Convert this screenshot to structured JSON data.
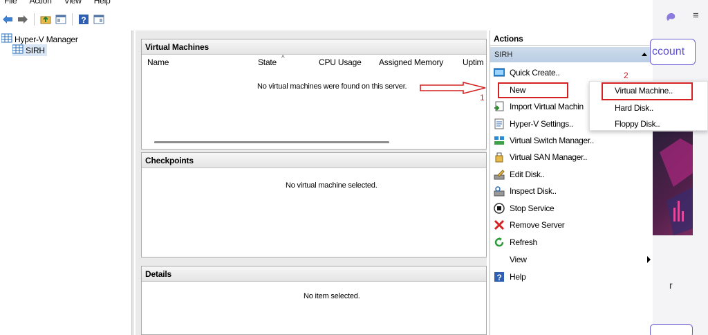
{
  "menu": [
    "File",
    "Action",
    "View",
    "Help"
  ],
  "tree": {
    "root": "Hyper-V Manager",
    "child": "SIRH"
  },
  "vm_panel": {
    "title": "Virtual Machines",
    "columns": [
      "Name",
      "State",
      "CPU Usage",
      "Assigned Memory",
      "Uptim"
    ],
    "sort_indicator": "^",
    "empty_message": "No virtual machines were found on this server."
  },
  "checkpoints": {
    "title": "Checkpoints",
    "message": "No virtual machine selected."
  },
  "details": {
    "title": "Details",
    "message": "No item selected."
  },
  "actions": {
    "header": "Actions",
    "group": "SIRH",
    "items": [
      {
        "label": "Quick Create..",
        "icon": "quick-create-icon"
      },
      {
        "label": "New",
        "icon": "none"
      },
      {
        "label": "Import Virtual Machin",
        "icon": "import-icon"
      },
      {
        "label": "Hyper-V Settings..",
        "icon": "settings-icon"
      },
      {
        "label": "Virtual Switch Manager..",
        "icon": "switch-icon"
      },
      {
        "label": "Virtual SAN Manager..",
        "icon": "san-icon"
      },
      {
        "label": "Edit Disk..",
        "icon": "edit-disk-icon"
      },
      {
        "label": "Inspect Disk..",
        "icon": "inspect-disk-icon"
      },
      {
        "label": "Stop Service",
        "icon": "stop-icon"
      },
      {
        "label": "Remove Server",
        "icon": "remove-icon"
      },
      {
        "label": "Refresh",
        "icon": "refresh-icon"
      },
      {
        "label": "View",
        "icon": "none"
      },
      {
        "label": "Help",
        "icon": "help-icon"
      }
    ]
  },
  "submenu": [
    "Virtual Machine..",
    "Hard Disk..",
    "Floppy Disk.."
  ],
  "annotations": {
    "step1": "1",
    "step2": "2"
  },
  "background": {
    "account_label": "ccount",
    "menu_glyph": "≡",
    "side_letter": "r"
  },
  "colors": {
    "annotation_red": "#d42020",
    "accent_purple": "#5a4fcf",
    "group_bar": "#c4d5ea"
  }
}
